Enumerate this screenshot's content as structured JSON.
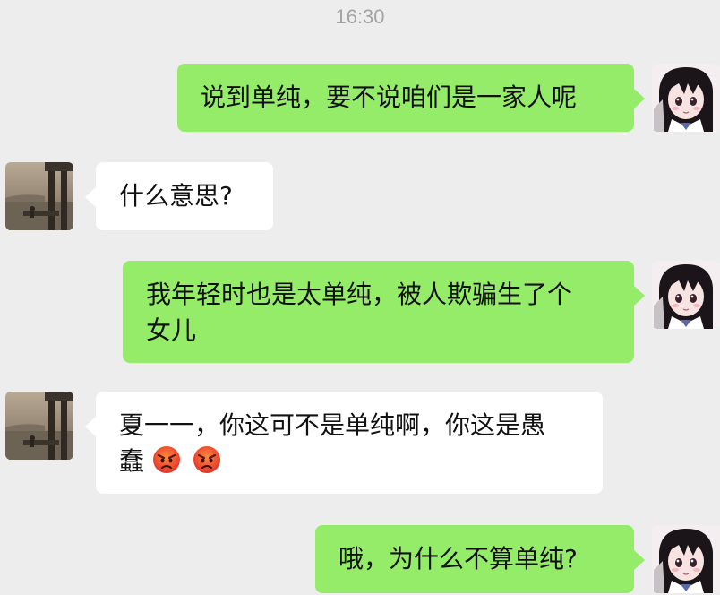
{
  "timestamp": "16:30",
  "colors": {
    "self_bubble": "#95ec69",
    "peer_bubble": "#ffffff",
    "background": "#ededed",
    "timestamp": "#a3a3a3"
  },
  "messages": [
    {
      "sender": "self",
      "avatar": "anime-girl-avatar",
      "text": "说到单纯，要不说咱们是一家人呢"
    },
    {
      "sender": "peer",
      "avatar": "seaside-column-avatar",
      "text": "什么意思?"
    },
    {
      "sender": "self",
      "avatar": "anime-girl-avatar",
      "line1": "我年轻时也是太单纯，被人欺骗生了个",
      "line2": "女儿"
    },
    {
      "sender": "peer",
      "avatar": "seaside-column-avatar",
      "line1": "夏一一，你这可不是单纯啊，你这是愚",
      "line2": "蠢",
      "emojis": [
        "angry-face-emoji",
        "angry-face-emoji"
      ]
    },
    {
      "sender": "self",
      "avatar": "anime-girl-avatar",
      "text": "哦，为什么不算单纯?"
    }
  ]
}
